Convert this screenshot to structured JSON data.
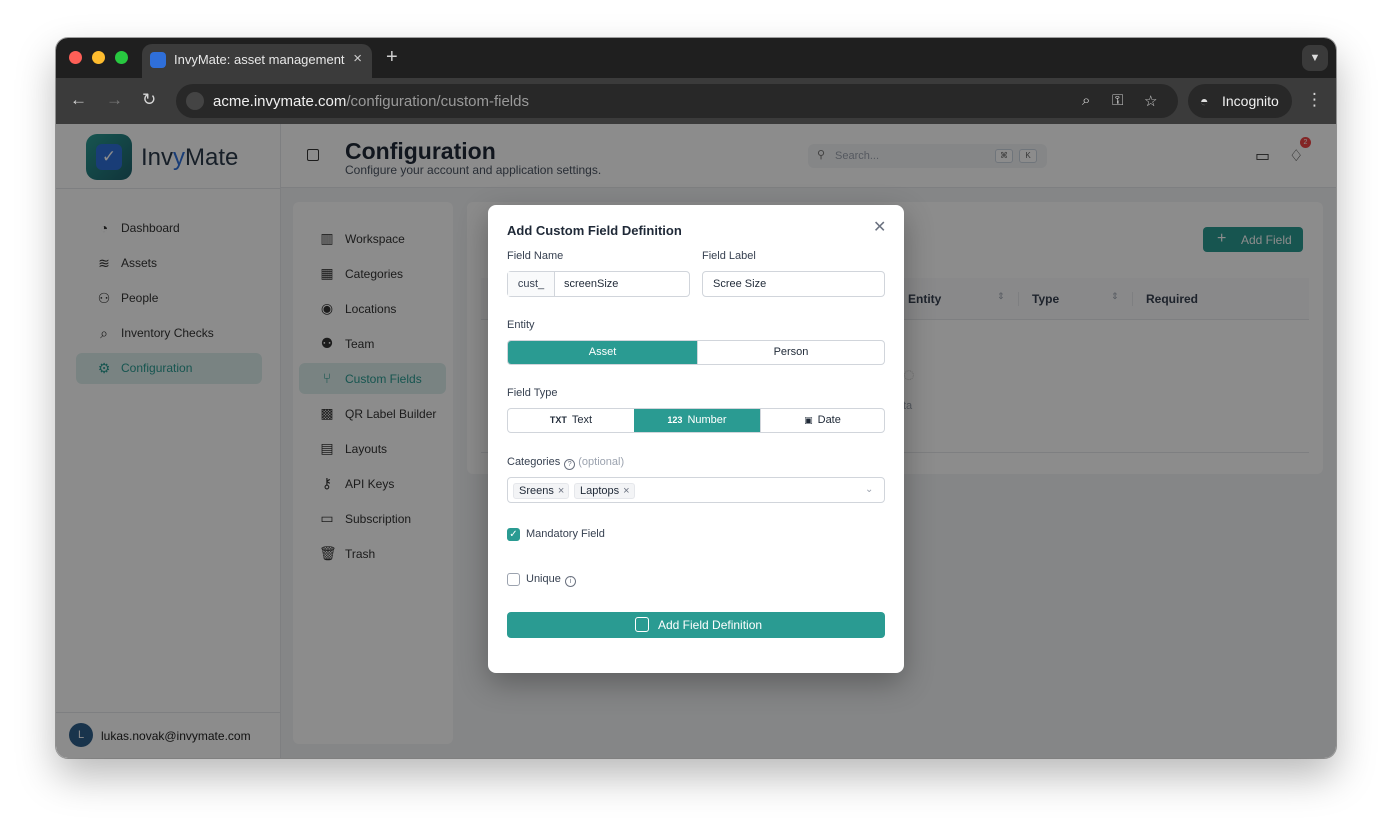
{
  "browser": {
    "tab_title": "InvyMate: asset management",
    "url_host": "acme.invymate.com",
    "url_path": "/configuration/custom-fields",
    "incognito_label": "Incognito"
  },
  "sidebar": {
    "logo_text_a": "Inv",
    "logo_text_b": "y",
    "logo_text_c": "Mate",
    "items": [
      {
        "label": "Dashboard",
        "icon": "pie-chart-icon"
      },
      {
        "label": "Assets",
        "icon": "layers-icon"
      },
      {
        "label": "People",
        "icon": "users-icon"
      },
      {
        "label": "Inventory Checks",
        "icon": "inventory-check-icon"
      },
      {
        "label": "Configuration",
        "icon": "sliders-icon",
        "active": true
      }
    ],
    "user_initial": "L",
    "user_email": "lukas.novak@invymate.com"
  },
  "header": {
    "title": "Configuration",
    "subtitle": "Configure your account and application settings.",
    "search_placeholder": "Search...",
    "kbd_1": "⌘",
    "kbd_2": "K",
    "notification_count": "2"
  },
  "subnav": {
    "items": [
      {
        "label": "Workspace",
        "icon": "building-icon"
      },
      {
        "label": "Categories",
        "icon": "grid-icon"
      },
      {
        "label": "Locations",
        "icon": "map-pin-icon"
      },
      {
        "label": "Team",
        "icon": "team-icon"
      },
      {
        "label": "Custom Fields",
        "icon": "custom-fields-icon",
        "active": true
      },
      {
        "label": "QR Label Builder",
        "icon": "qr-code-icon"
      },
      {
        "label": "Layouts",
        "icon": "layout-icon"
      },
      {
        "label": "API Keys",
        "icon": "key-icon"
      },
      {
        "label": "Subscription",
        "icon": "credit-card-icon"
      },
      {
        "label": "Trash",
        "icon": "trash-icon"
      }
    ]
  },
  "content": {
    "add_field_label": "Add Field",
    "columns": [
      "Entity",
      "Type",
      "Required"
    ],
    "empty_text_fragment": "ta"
  },
  "modal": {
    "title": "Add Custom Field Definition",
    "field_name_label": "Field Name",
    "field_name_prefix": "cust_",
    "field_name_value": "screenSize",
    "field_label_label": "Field Label",
    "field_label_value": "Scree Size",
    "entity_label": "Entity",
    "entity_options": [
      "Asset",
      "Person"
    ],
    "entity_selected": "Asset",
    "field_type_label": "Field Type",
    "field_type_options": [
      {
        "label": "Text",
        "glyph": "TXT"
      },
      {
        "label": "Number",
        "glyph": "123"
      },
      {
        "label": "Date",
        "glyph": ""
      }
    ],
    "field_type_selected": "Number",
    "categories_label": "Categories",
    "categories_optional": "(optional)",
    "categories_selected": [
      "Sreens",
      "Laptops"
    ],
    "mandatory_label": "Mandatory Field",
    "mandatory_checked": true,
    "unique_label": "Unique",
    "unique_checked": false,
    "submit_label": "Add Field Definition"
  },
  "colors": {
    "accent": "#2a9b92",
    "accent_light": "#dcefed",
    "badge": "#ef4444"
  }
}
